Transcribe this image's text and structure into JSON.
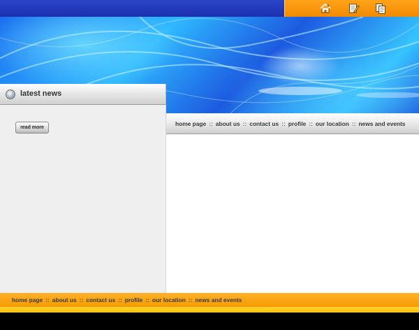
{
  "topbar": {
    "icons": [
      {
        "name": "home-icon"
      },
      {
        "name": "edit-icon"
      },
      {
        "name": "copy-icon"
      }
    ]
  },
  "sidebar": {
    "title": "latest news",
    "read_more_label": "read more"
  },
  "main_nav": {
    "items": [
      "home page",
      "about us",
      "contact us",
      "profile",
      "our location",
      "news and events"
    ],
    "separator": "::"
  },
  "footer_nav": {
    "items": [
      "home page",
      "about us",
      "contact us",
      "profile",
      "our location",
      "news and events"
    ],
    "separator": "::"
  },
  "colors": {
    "topbar_blue": "#1a30b0",
    "accent_orange": "#f49a00",
    "footer_yellow": "#ffc400"
  }
}
